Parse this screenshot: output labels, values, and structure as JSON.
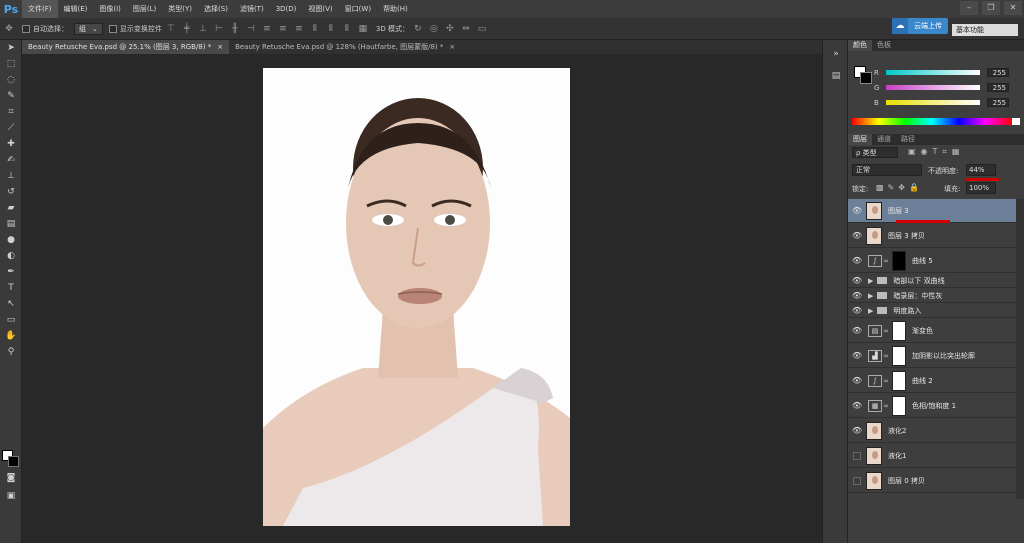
{
  "app": {
    "logo": "Ps"
  },
  "menu": [
    "文件(F)",
    "编辑(E)",
    "图像(I)",
    "图层(L)",
    "类型(Y)",
    "选择(S)",
    "滤镜(T)",
    "3D(D)",
    "视图(V)",
    "窗口(W)",
    "帮助(H)"
  ],
  "options": {
    "auto_select_label": "自动选择：",
    "auto_select_value": "组",
    "show_transform_label": "显示变换控件",
    "mode_3d_label": "3D 模式："
  },
  "upload_label": "云端上传",
  "workspace": "基本功能",
  "doc_tabs": [
    {
      "title": "Beauty Retusche Eva.psd @ 25.1% (图层 3, RGB/8) *",
      "close": "×"
    },
    {
      "title": "Beauty Retusche Eva.psd @ 128% (Hautfarbe, 图层蒙版/8) *",
      "close": "×"
    }
  ],
  "color_panel": {
    "tabs": [
      "颜色",
      "色板"
    ],
    "channels": [
      {
        "label": "R",
        "value": "255",
        "color": "#00c8c8"
      },
      {
        "label": "G",
        "value": "255",
        "color": "#c840c8"
      },
      {
        "label": "B",
        "value": "255",
        "color": "#e8e000"
      }
    ]
  },
  "layers_panel": {
    "tabs": [
      "图层",
      "通道",
      "路径"
    ],
    "filter_label": "ρ 类型",
    "blend_mode": "正常",
    "opacity_label": "不透明度:",
    "opacity_value": "44%",
    "lock_label": "锁定:",
    "fill_label": "填充:",
    "fill_value": "100%",
    "layers": [
      {
        "name": "图层 3",
        "visible": true,
        "selected": true
      },
      {
        "name": "图层 3 拷贝",
        "visible": true
      },
      {
        "name": "曲线 5",
        "visible": true
      },
      {
        "name": "暗部以下 双曲线",
        "visible": true,
        "group": true
      },
      {
        "name": "暗录层：中性灰",
        "visible": true,
        "group": true
      },
      {
        "name": "明度路入",
        "visible": true,
        "group": true
      },
      {
        "name": "渐变色",
        "visible": true
      },
      {
        "name": "加阴影以比突出轮廓",
        "visible": true
      },
      {
        "name": "曲线 2",
        "visible": true
      },
      {
        "name": "色相/饱和度 1",
        "visible": true
      },
      {
        "name": "液化2",
        "visible": true
      },
      {
        "name": "液化1",
        "visible": false
      },
      {
        "name": "图层 0 拷贝",
        "visible": false
      }
    ]
  },
  "colors": {
    "accent": "#4aa8ef",
    "selection": "#6c7f99",
    "annotation": "#d40000"
  }
}
